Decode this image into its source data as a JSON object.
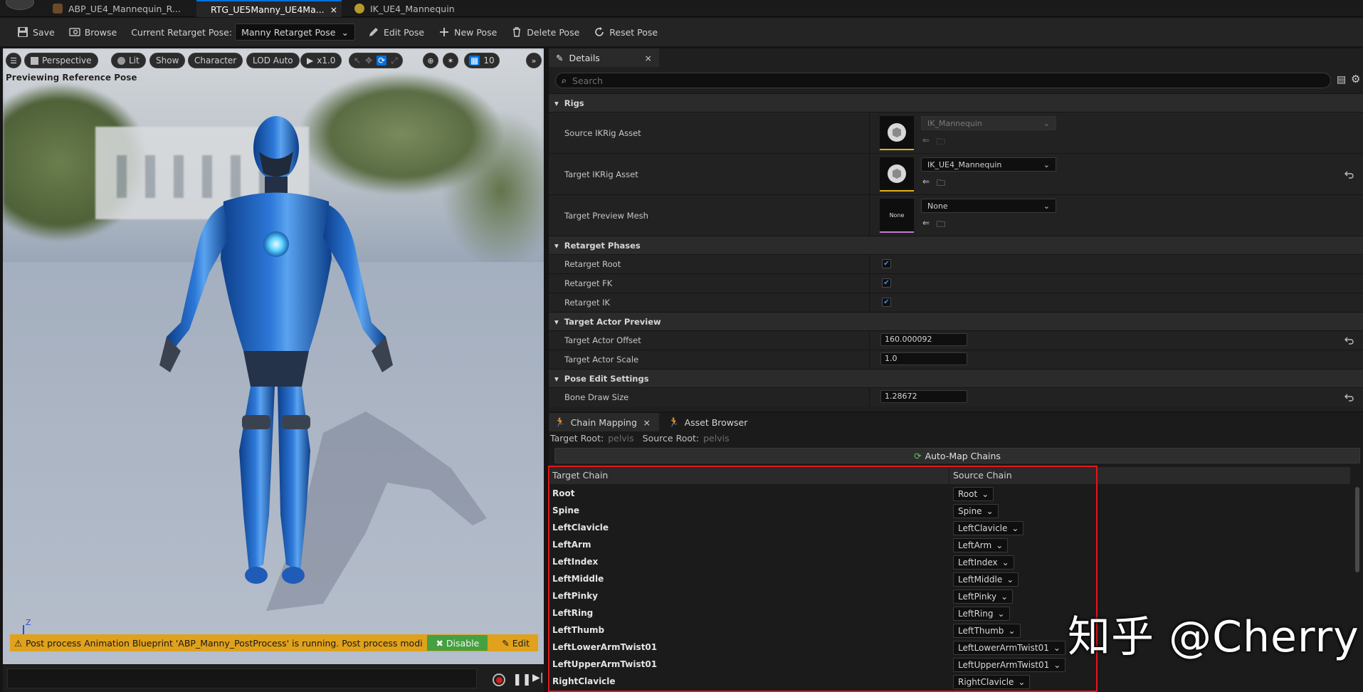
{
  "tabs": [
    {
      "label": "ABP_UE4_Mannequin_R..."
    },
    {
      "label": "RTG_UE5Manny_UE4Ma...",
      "close": "×"
    },
    {
      "label": "IK_UE4_Mannequin"
    }
  ],
  "toolbar": {
    "save": "Save",
    "browse": "Browse",
    "pose_label": "Current Retarget Pose:",
    "pose_value": "Manny Retarget Pose",
    "edit_pose": "Edit Pose",
    "new_pose": "New Pose",
    "delete_pose": "Delete Pose",
    "reset_pose": "Reset Pose"
  },
  "viewport": {
    "perspective": "Perspective",
    "lit": "Lit",
    "show": "Show",
    "character": "Character",
    "lod": "LOD Auto",
    "speed": "x1.0",
    "grid_size": "10",
    "preview_label": "Previewing Reference Pose",
    "axis_z": "Z",
    "warning": "Post process Animation Blueprint 'ABP_Manny_PostProcess' is running. Post process modi",
    "disable": "Disable",
    "edit": "Edit"
  },
  "details": {
    "tab": "Details",
    "tab_close": "×",
    "search_placeholder": "Search",
    "sections": {
      "rigs": "Rigs",
      "phases": "Retarget Phases",
      "actor_preview": "Target Actor Preview",
      "pose_edit": "Pose Edit Settings"
    },
    "source_ikrig": {
      "label": "Source IKRig Asset",
      "value": "IK_Mannequin"
    },
    "target_ikrig": {
      "label": "Target IKRig Asset",
      "value": "IK_UE4_Mannequin"
    },
    "preview_mesh": {
      "label": "Target Preview Mesh",
      "value": "None",
      "thumb": "None"
    },
    "retarget_root": {
      "label": "Retarget Root",
      "checked": true
    },
    "retarget_fk": {
      "label": "Retarget FK",
      "checked": true
    },
    "retarget_ik": {
      "label": "Retarget IK",
      "checked": true
    },
    "actor_offset": {
      "label": "Target Actor Offset",
      "value": "160.000092"
    },
    "actor_scale": {
      "label": "Target Actor Scale",
      "value": "1.0"
    },
    "bone_draw": {
      "label": "Bone Draw Size",
      "value": "1.28672"
    }
  },
  "chain_mapping": {
    "tab": "Chain Mapping",
    "tab_close": "×",
    "asset_browser_tab": "Asset Browser",
    "target_root_label": "Target Root:",
    "target_root_value": "pelvis",
    "source_root_label": "Source Root:",
    "source_root_value": "pelvis",
    "auto_map": "Auto-Map Chains",
    "col_target": "Target Chain",
    "col_source": "Source Chain",
    "rows": [
      {
        "target": "Root",
        "source": "Root"
      },
      {
        "target": "Spine",
        "source": "Spine"
      },
      {
        "target": "LeftClavicle",
        "source": "LeftClavicle"
      },
      {
        "target": "LeftArm",
        "source": "LeftArm"
      },
      {
        "target": "LeftIndex",
        "source": "LeftIndex"
      },
      {
        "target": "LeftMiddle",
        "source": "LeftMiddle"
      },
      {
        "target": "LeftPinky",
        "source": "LeftPinky"
      },
      {
        "target": "LeftRing",
        "source": "LeftRing"
      },
      {
        "target": "LeftThumb",
        "source": "LeftThumb"
      },
      {
        "target": "LeftLowerArmTwist01",
        "source": "LeftLowerArmTwist01"
      },
      {
        "target": "LeftUpperArmTwist01",
        "source": "LeftUpperArmTwist01"
      },
      {
        "target": "RightClavicle",
        "source": "RightClavicle"
      }
    ]
  },
  "watermark": "知乎 @Cherry",
  "colors": {
    "accent": "#0070e0",
    "highlight_box": "#e8141b",
    "warning": "#e0a11c",
    "disable": "#45a040"
  }
}
